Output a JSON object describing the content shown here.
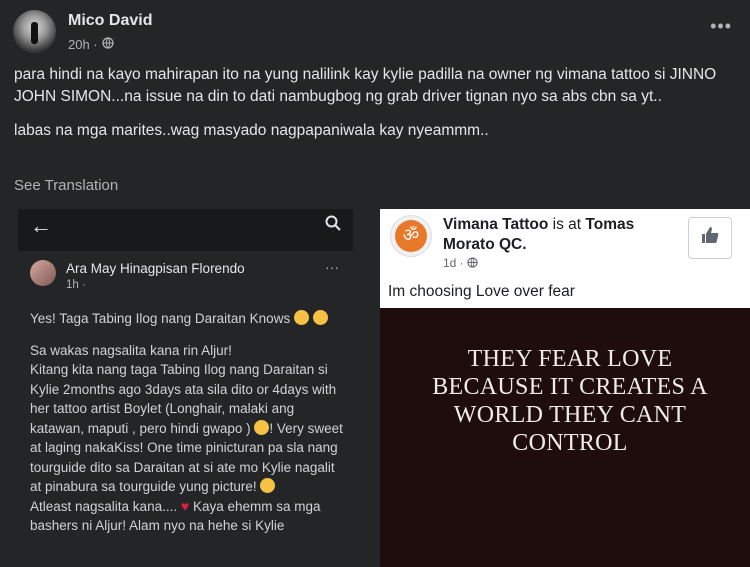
{
  "post": {
    "author": "Mico David",
    "time": "20h ·",
    "more": "•••",
    "paragraphs": [
      "para hindi na kayo mahirapan ito na yung nalilink kay kylie padilla na owner ng vimana tattoo si JINNO JOHN SIMON...na issue na din to dati nambugbog ng grab driver tignan nyo sa abs cbn sa yt..",
      "labas na mga marites..wag masyado nagpapaniwala kay nyeammm.."
    ],
    "see_translation": "See Translation"
  },
  "left_screenshot": {
    "name": "Ara May Hinagpisan Florendo",
    "time": "1h ·",
    "more": "···",
    "lines": {
      "p1": "Yes! Taga Tabing Ilog nang Daraitan Knows",
      "p2": "Sa wakas nagsalita kana rin Aljur!",
      "p3a": "Kitang kita nang taga Tabing Ilog nang Daraitan si Kylie 2months ago 3days ata sila dito or 4days with her tattoo artist Boylet (Longhair, malaki ang katawan, maputi , pero hindi gwapo )",
      "p3b": "! Very sweet at laging nakaKiss! One time pinicturan pa sla nang tourguide dito sa Daraitan at si ate mo Kylie nagalit at pinabura sa tourguide yung picture!",
      "p4a": "Atleast nagsalita kana....",
      "p4b": "Kaya ehemm sa mga bashers ni Aljur! Alam nyo na hehe si Kylie"
    }
  },
  "right_screenshot": {
    "page_name": "Vimana Tattoo",
    "is_at": " is at ",
    "location": "Tomas Morato QC.",
    "time": "1d ·",
    "caption": "Im choosing Love over fear",
    "quote_lines": [
      "THEY FEAR LOVE",
      "BECAUSE IT CREATES A",
      "WORLD THEY CANT",
      "CONTROL"
    ]
  },
  "icons": [
    "globe-icon",
    "back-arrow-icon",
    "search-icon",
    "thumbs-up-icon",
    "om-icon",
    "more-options-icon"
  ]
}
